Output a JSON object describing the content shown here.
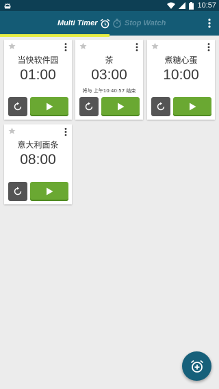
{
  "status_bar": {
    "time": "10:57",
    "icons": [
      "android-debug-icon",
      "wifi-icon",
      "signal-icon",
      "battery-icon"
    ]
  },
  "tabs": [
    {
      "label": "Multi Timer",
      "icon": "alarm-clock-icon",
      "selected": true
    },
    {
      "label": "Stop Watch",
      "icon": "stopwatch-icon",
      "selected": false
    }
  ],
  "colors": {
    "status_bar": "#0d3f54",
    "app_bar": "#145b75",
    "tab_indicator": "#e6ec45",
    "play_button": "#6aa832",
    "reset_button": "#555555",
    "fab": "#16607a",
    "background": "#ececec"
  },
  "timers": [
    {
      "name": "当快软件园",
      "time": "01:00",
      "subtitle": ""
    },
    {
      "name": "茶",
      "time": "03:00",
      "subtitle": "将与 上午10:40:57 结束"
    },
    {
      "name": "煮糖心蛋",
      "time": "10:00",
      "subtitle": ""
    },
    {
      "name": "意大利面条",
      "time": "08:00",
      "subtitle": ""
    }
  ],
  "fab": {
    "icon": "add-alarm-icon"
  }
}
